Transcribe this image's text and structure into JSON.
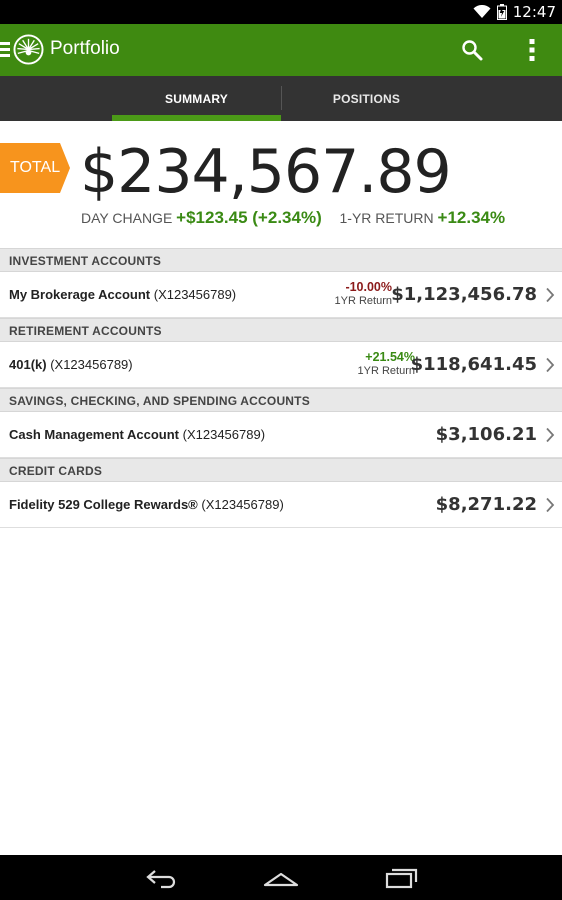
{
  "status_bar": {
    "time": "12:47",
    "icons": [
      "wifi-icon",
      "battery-icon"
    ]
  },
  "app_bar": {
    "title": "Portfolio",
    "icons": [
      "menu-icon",
      "fidelity-logo",
      "search-icon",
      "overflow-menu-icon"
    ],
    "accent_color": "#3f8a11"
  },
  "tabs": [
    {
      "label": "SUMMARY",
      "selected": true
    },
    {
      "label": "POSITIONS",
      "selected": false
    }
  ],
  "total": {
    "badge": "TOTAL",
    "value": "$234,567.89",
    "day_change_label": "DAY CHANGE",
    "day_change_value": "+$123.45 (+2.34%)",
    "return_label": "1-YR RETURN",
    "return_value": "+12.34%",
    "badge_color": "#f7941d",
    "positive_color": "#3a8a14"
  },
  "sections": [
    {
      "header": "INVESTMENT ACCOUNTS",
      "accounts": [
        {
          "name": "My Brokerage Account",
          "number": "(X123456789)",
          "return_pct": "-10.00%",
          "return_label": "1YR Return",
          "balance": "$1,123,456.78"
        }
      ]
    },
    {
      "header": "RETIREMENT ACCOUNTS",
      "accounts": [
        {
          "name": "401(k)",
          "number": "(X123456789)",
          "return_pct": "+21.54%",
          "return_label": "1YR Return",
          "balance": "$118,641.45"
        }
      ]
    },
    {
      "header": "SAVINGS, CHECKING, AND SPENDING ACCOUNTS",
      "accounts": [
        {
          "name": "Cash Management Account",
          "number": "(X123456789)",
          "balance": "$3,106.21"
        }
      ]
    },
    {
      "header": "CREDIT CARDS",
      "accounts": [
        {
          "name": "Fidelity 529 College Rewards®",
          "number": "(X123456789)",
          "balance": "$8,271.22"
        }
      ]
    }
  ],
  "nav_bar": {
    "icons": [
      "back-icon",
      "home-icon",
      "recent-apps-icon"
    ]
  }
}
